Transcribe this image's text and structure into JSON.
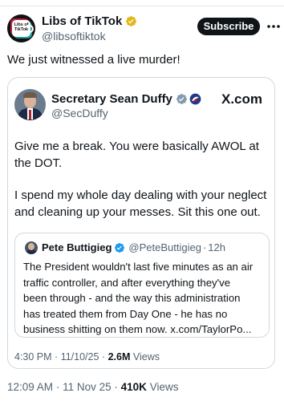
{
  "main_post": {
    "author_name": "Libs of TikTok",
    "author_handle": "@libsoftiktok",
    "avatar_text": "Libs of TikTok",
    "subscribe_label": "Subscribe",
    "text": "We just witnessed a live murder!",
    "time": "12:09 AM",
    "date": "11 Nov 25",
    "views": "410K",
    "views_label": "Views",
    "separator": "·"
  },
  "quoted_post": {
    "author_name": "Secretary Sean Duffy",
    "author_handle": "@SecDuffy",
    "brand_logo": "X.com",
    "lines": [
      "Give me a break. You were basically AWOL at",
      "the DOT.",
      "I spend my whole day dealing with your neglect",
      "and cleaning up your messes. Sit this one out."
    ],
    "time": "4:30 PM",
    "date": "11/10/25",
    "views": "2.6M",
    "views_label": "Views",
    "separator": "·"
  },
  "nested_post": {
    "author_name": "Pete Buttigieg",
    "author_handle": "@PeteButtigieg",
    "time": "12h",
    "separator": "·",
    "lines": [
      "The President wouldn't last five minutes as an air",
      "traffic controller, and after everything they've",
      "been through - and the way this administration",
      "has treated them from Day One - he has no",
      "business shitting on them now. x.com/TaylorPo..."
    ]
  },
  "icons": {
    "verified_gold": "verified-gold-badge-icon",
    "verified_grey": "verified-grey-badge-icon",
    "government": "government-affiliation-icon",
    "verified_blue": "verified-blue-badge-icon",
    "more": "more-options-icon"
  },
  "colors": {
    "text_primary": "#0f1419",
    "text_secondary": "#536471",
    "border": "#cfd9de",
    "gold_badge": "#e2b719",
    "blue_badge": "#1d9bf0",
    "grey_badge": "#829aab",
    "button_bg": "#0f1419"
  }
}
